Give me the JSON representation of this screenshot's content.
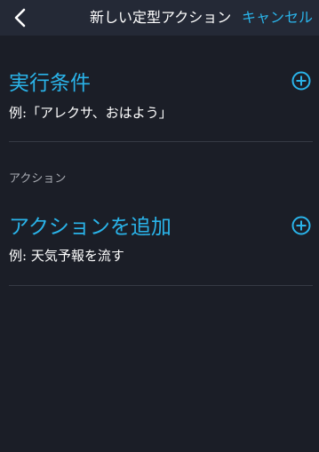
{
  "header": {
    "title": "新しい定型アクション",
    "cancel_label": "キャンセル"
  },
  "trigger_section": {
    "title": "実行条件",
    "example": "例:「アレクサ、おはよう」"
  },
  "action_group_label": "アクション",
  "action_section": {
    "title": "アクションを追加",
    "example": "例: 天気予報を流す"
  },
  "colors": {
    "accent": "#2ab4ea",
    "background": "#1b1e27",
    "header_background": "#242936",
    "divider": "#363a45",
    "label_gray": "#a9acb3"
  },
  "icons": [
    "chevron-left-icon",
    "plus-circle-icon"
  ]
}
